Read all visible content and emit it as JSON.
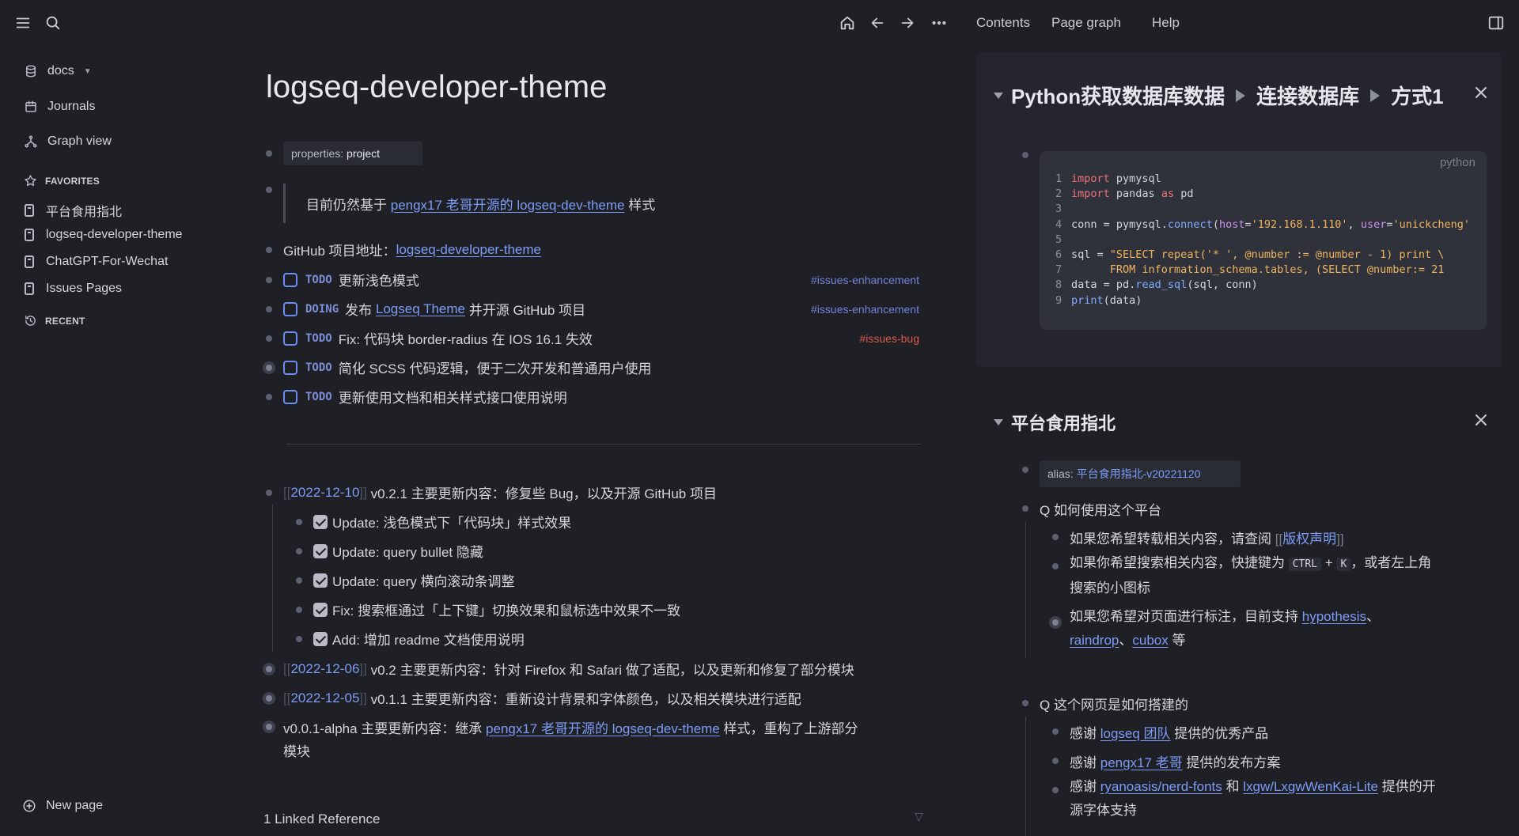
{
  "topbar": {
    "nav": [
      "Contents",
      "Page graph",
      "Help"
    ]
  },
  "sidebar": {
    "graph_name": "docs",
    "items": [
      "Journals",
      "Graph view"
    ],
    "favorites_label": "FAVORITES",
    "favorites": [
      "平台食用指北",
      "logseq-developer-theme",
      "ChatGPT-For-Wechat",
      "Issues Pages"
    ],
    "recent_label": "RECENT",
    "new_page": "New page"
  },
  "page": {
    "title": "logseq-developer-theme",
    "properties": {
      "key": "properties:",
      "value": "project"
    },
    "quote": {
      "prefix": "目前仍然基于",
      "link": "pengx17 老哥开源的 logseq-dev-theme",
      "suffix": "样式"
    },
    "github": {
      "label": "GitHub 项目地址：",
      "link": "logseq-developer-theme"
    },
    "tasks": [
      {
        "marker": "TODO",
        "pre": "更新浅色模式",
        "link": "",
        "post": "",
        "tag": "#issues-enhancement"
      },
      {
        "marker": "DOING",
        "pre": "发布",
        "link": "Logseq Theme",
        "post": "并开源 GitHub 项目",
        "tag": "#issues-enhancement"
      },
      {
        "marker": "TODO",
        "pre": "Fix: 代码块 border-radius 在 IOS 16.1 失效",
        "link": "",
        "post": "",
        "tag": "#issues-bug"
      },
      {
        "marker": "TODO",
        "pre": "简化 SCSS 代码逻辑，便于二次开发和普通用户使用",
        "link": "",
        "post": "",
        "tag": ""
      },
      {
        "marker": "TODO",
        "pre": "更新使用文档和相关样式接口使用说明",
        "link": "",
        "post": "",
        "tag": ""
      }
    ],
    "changelog": [
      {
        "date": "2022-12-10",
        "text": "v0.2.1 主要更新内容：修复些 Bug，以及开源 GitHub 项目"
      },
      {
        "date": "2022-12-06",
        "text": "v0.2 主要更新内容：针对 Firefox 和 Safari 做了适配，以及更新和修复了部分模块"
      },
      {
        "date": "2022-12-05",
        "text": "v0.1.1 主要更新内容：重新设计背景和字体颜色，以及相关模块进行适配"
      }
    ],
    "subitems": [
      "Update: 浅色模式下「代码块」样式效果",
      "Update: query bullet 隐藏",
      "Update: query 横向滚动条调整",
      "Fix: 搜索框通过「上下键」切换效果和鼠标选中效果不一致",
      "Add: 增加 readme 文档使用说明"
    ],
    "alpha": {
      "pre": "v0.0.1-alpha 主要更新内容：继承",
      "link": "pengx17 老哥开源的 logseq-dev-theme",
      "post": "样式，重构了上游部分",
      "line2": "模块"
    },
    "linked_refs": "1 Linked Reference"
  },
  "right": {
    "card1": {
      "crumbs": [
        "Python获取数据库数据",
        "连接数据库",
        "方式1"
      ],
      "lang": "python"
    },
    "card2": {
      "title": "平台食用指北",
      "alias_key": "alias:",
      "alias_value": "平台食用指北-v20221120",
      "q1": "Q 如何使用这个平台",
      "q1_items": {
        "a_pre": "如果您希望转载相关内容，请查阅",
        "a_link": "版权声明",
        "b_pre": "如果你希望搜索相关内容，快捷键为",
        "b_kbd1": "CTRL",
        "b_plus": "+",
        "b_kbd2": "K",
        "b_post": "，或者左上角",
        "b_line2": "搜索的小图标",
        "c_pre": "如果您希望对页面进行标注，目前支持",
        "c_link1": "hypothesis",
        "c_sep1": "、",
        "c_link2": "raindrop",
        "c_sep2": "、",
        "c_link3": "cubox",
        "c_post": "等"
      },
      "q2": "Q 这个网页是如何搭建的",
      "q2_items": {
        "a_pre": "感谢",
        "a_link": "logseq 团队",
        "a_post": "提供的优秀产品",
        "b_pre": "感谢",
        "b_link": "pengx17 老哥",
        "b_post": "提供的发布方案",
        "c_pre": "感谢",
        "c_link1": "ryanoasis/nerd-fonts",
        "c_mid": "和",
        "c_link2": "lxgw/LxgwWenKai-Lite",
        "c_post": "提供的开",
        "c_line2": "源字体支持"
      }
    }
  },
  "colors": {
    "background": "#1f2026",
    "link": "#7d9cf6",
    "tag_bug": "#d9584a",
    "marker": "#7d8fd6"
  }
}
